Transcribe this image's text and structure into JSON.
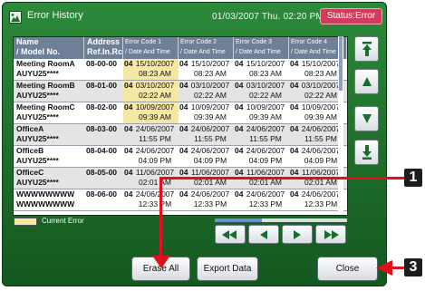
{
  "window": {
    "title": "Error History",
    "datetime": "01/03/2007 Thu. 02:20 PM",
    "status": "Status:Error"
  },
  "table": {
    "headers": {
      "name": [
        "Name",
        "/ Model No."
      ],
      "address": [
        "Address",
        "Ref.In.Rc"
      ],
      "codes": [
        [
          "Error Code 1",
          "/ Date And Time"
        ],
        [
          "Error Code 2",
          "/ Date And Time"
        ],
        [
          "Error Code 3",
          "/ Date And Time"
        ],
        [
          "Error Code 4",
          "/ Date And Time"
        ]
      ]
    },
    "rows": [
      {
        "name": "Meeting RoomA",
        "model": "AUYU25****",
        "address": "08-00-00",
        "codes": [
          {
            "code": "04",
            "date": "15/10/2007",
            "time": "08:23 AM",
            "current": true
          },
          {
            "code": "04",
            "date": "15/10/2007",
            "time": "08:23 AM"
          },
          {
            "code": "04",
            "date": "15/10/2007",
            "time": "08:23 AM"
          },
          {
            "code": "04",
            "date": "15/10/2007",
            "time": "08:23 AM"
          }
        ]
      },
      {
        "name": "Meeting RoomB",
        "model": "AUYU25****",
        "address": "08-01-00",
        "codes": [
          {
            "code": "04",
            "date": "03/10/2007",
            "time": "02:22 AM",
            "current": true
          },
          {
            "code": "04",
            "date": "03/10/2007",
            "time": "02:22 AM"
          },
          {
            "code": "04",
            "date": "03/10/2007",
            "time": "02:22 AM"
          },
          {
            "code": "04",
            "date": "03/10/2007",
            "time": "02:22 AM"
          }
        ]
      },
      {
        "name": "Meeting RoomC",
        "model": "AUYU25****",
        "address": "08-02-00",
        "codes": [
          {
            "code": "04",
            "date": "10/09/2007",
            "time": "09:39 AM",
            "current": true
          },
          {
            "code": "04",
            "date": "10/09/2007",
            "time": "09:39 AM"
          },
          {
            "code": "04",
            "date": "10/09/2007",
            "time": "09:39 AM"
          },
          {
            "code": "04",
            "date": "10/09/2007",
            "time": "09:39 AM"
          }
        ]
      },
      {
        "name": "OfficeA",
        "model": "AUYU25****",
        "address": "08-03-00",
        "codes": [
          {
            "code": "04",
            "date": "24/06/2007",
            "time": "11:55 PM"
          },
          {
            "code": "04",
            "date": "24/06/2007",
            "time": "11:55 PM"
          },
          {
            "code": "04",
            "date": "24/06/2007",
            "time": "11:55 PM"
          },
          {
            "code": "04",
            "date": "24/06/2007",
            "time": "11:55 PM"
          }
        ]
      },
      {
        "name": "OfficeB",
        "model": "AUYU25****",
        "address": "08-04-00",
        "codes": [
          {
            "code": "04",
            "date": "24/06/2007",
            "time": "04:09 PM"
          },
          {
            "code": "04",
            "date": "24/06/2007",
            "time": "04:09 PM"
          },
          {
            "code": "04",
            "date": "24/06/2007",
            "time": "04:09 PM"
          },
          {
            "code": "04",
            "date": "24/06/2007",
            "time": "04:09 PM"
          }
        ]
      },
      {
        "name": "OfficeC",
        "model": "AUYU25****",
        "address": "08-05-00",
        "codes": [
          {
            "code": "04",
            "date": "11/06/2007",
            "time": "02:01 AM"
          },
          {
            "code": "04",
            "date": "11/06/2007",
            "time": "02:01 AM"
          },
          {
            "code": "04",
            "date": "11/06/2007",
            "time": "02:01 AM"
          },
          {
            "code": "04",
            "date": "11/06/2007",
            "time": "02:01 AM"
          }
        ]
      },
      {
        "name": "WWWWWWWW",
        "model": "WWWWWWWW",
        "address": "08-06-00",
        "codes": [
          {
            "code": "04",
            "date": "24/06/2007",
            "time": "12:33 PM"
          },
          {
            "code": "04",
            "date": "24/06/2007",
            "time": "12:33 PM"
          },
          {
            "code": "04",
            "date": "24/06/2007",
            "time": "12:33 PM"
          },
          {
            "code": "04",
            "date": "24/06/2007",
            "time": "12:33 PM"
          }
        ]
      }
    ]
  },
  "legend": {
    "label": "Current Error",
    "color": "#f5e7a4"
  },
  "buttons": {
    "erase_all": "Erase All",
    "export_data": "Export Data",
    "close": "Close"
  },
  "callouts": [
    "1",
    "3"
  ],
  "colors": {
    "panel": "#1e6d2a",
    "header": "#6f7f97",
    "status": "#d23c5a",
    "callout": "#e2101c"
  }
}
